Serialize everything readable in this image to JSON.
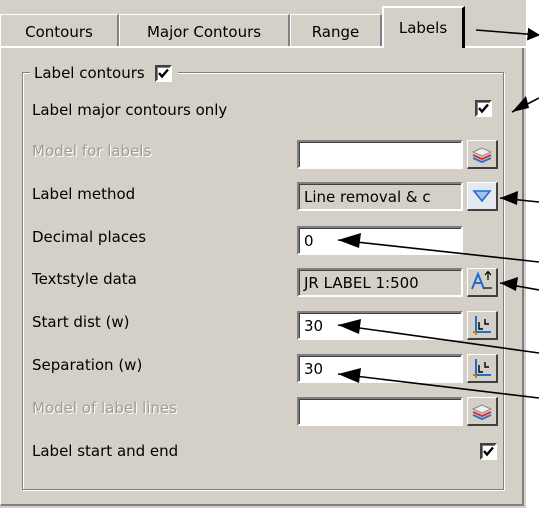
{
  "tabs": [
    {
      "label": "Contours",
      "active": false
    },
    {
      "label": "Major Contours",
      "active": false
    },
    {
      "label": "Range",
      "active": false
    },
    {
      "label": "Labels",
      "active": true
    }
  ],
  "group": {
    "label": "Label contours",
    "checked": true
  },
  "rows": {
    "major_only": {
      "label": "Label major contours only",
      "checked": true
    },
    "model_for_labels": {
      "label": "Model for labels",
      "value": "",
      "disabled": true,
      "icon": "model-layers-icon"
    },
    "label_method": {
      "label": "Label method",
      "value": "Line removal & c",
      "icon": "dropdown-arrow-icon"
    },
    "decimal_places": {
      "label": "Decimal places",
      "value": "0"
    },
    "textstyle_data": {
      "label": "Textstyle data",
      "value": "JR LABEL 1:500",
      "icon": "textstyle-icon"
    },
    "start_dist": {
      "label": "Start dist (w)",
      "value": "30",
      "icon": "pick-distance-icon"
    },
    "separation": {
      "label": "Separation (w)",
      "value": "30",
      "icon": "pick-distance-icon"
    },
    "model_of_label_lines": {
      "label": "Model of label lines",
      "value": "",
      "disabled": true,
      "icon": "model-layers-icon"
    },
    "label_start_end": {
      "label": "Label start and end",
      "checked": true
    }
  },
  "colors": {
    "dialog_bg": "#d4d0c8",
    "dropdown_accent": "#1c6ed4",
    "disabled_text": "#a09c94"
  }
}
